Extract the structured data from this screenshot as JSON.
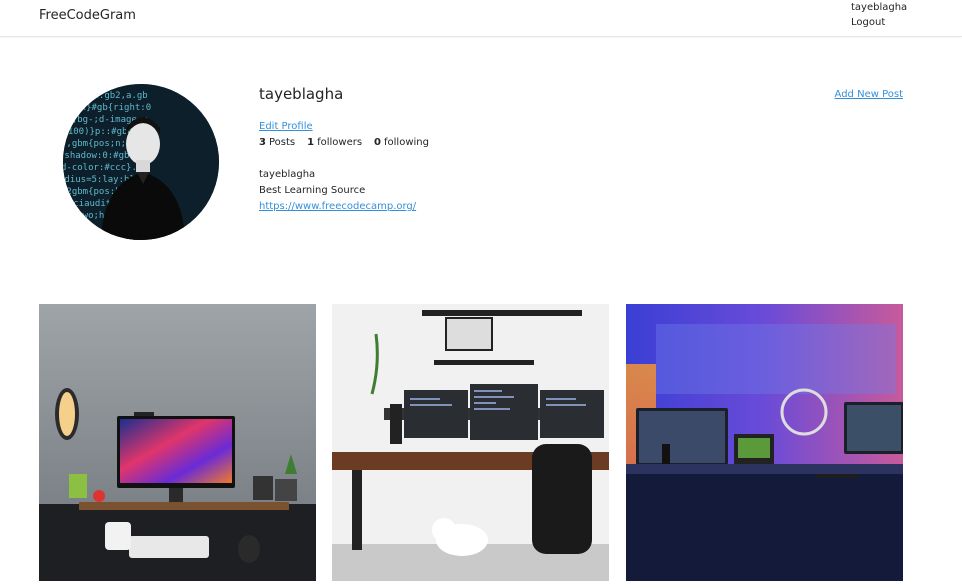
{
  "nav": {
    "brand": "FreeCodeGram",
    "user": "tayeblagha",
    "logout": "Logout"
  },
  "profile": {
    "username": "tayeblagha",
    "add_post": "Add New Post",
    "edit_profile": "Edit Profile",
    "stats": {
      "posts_count": "3",
      "posts_label": "Posts",
      "followers_count": "1",
      "followers_label": "followers",
      "following_count": "0",
      "following_label": "following"
    },
    "title": "tayeblagha",
    "description": "Best Learning Source",
    "url": "https://www.freecodecamp.org/"
  },
  "posts": [
    {
      "subject": "desk setup with colorful monitor and keyboard"
    },
    {
      "subject": "triple monitor desk setup with dog"
    },
    {
      "subject": "neon lit gaming desk setup"
    }
  ],
  "colors": {
    "link": "#3490dc",
    "text": "#212529"
  }
}
